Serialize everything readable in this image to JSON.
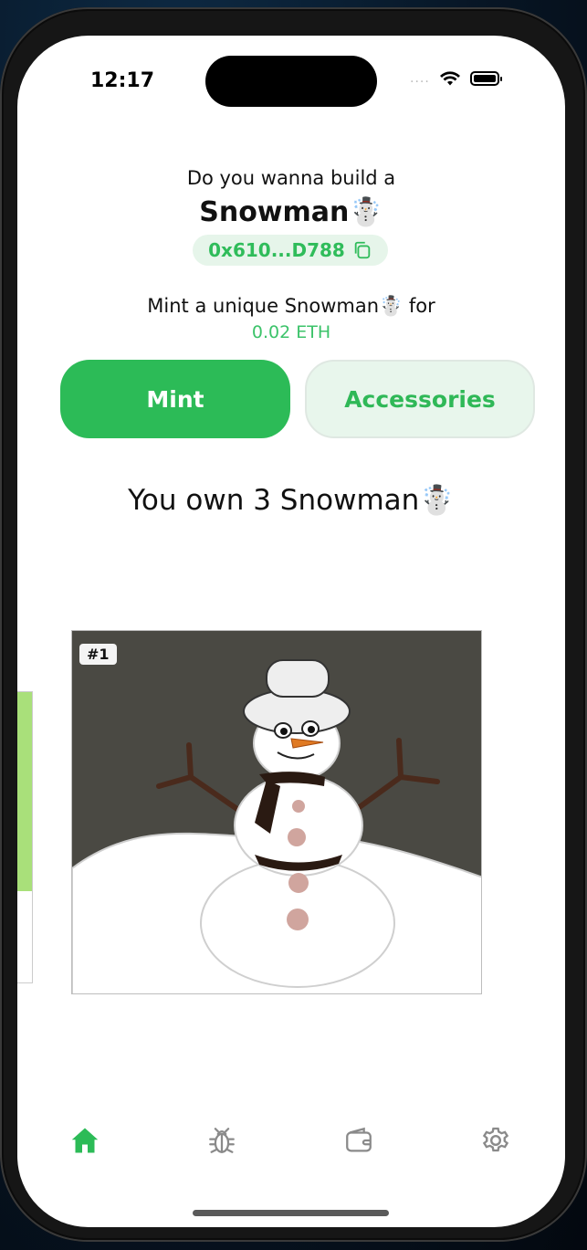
{
  "status_bar": {
    "time": "12:17",
    "signal": "...."
  },
  "header": {
    "subtitle": "Do you wanna build a",
    "title": "Snowman☃️",
    "address": "0x610...D788"
  },
  "mint_section": {
    "description": "Mint a unique Snowman☃️ for",
    "price": "0.02 ETH"
  },
  "buttons": {
    "mint_label": "Mint",
    "accessories_label": "Accessories"
  },
  "ownership": {
    "text": "You own 3 Snowman☃️"
  },
  "nft_card": {
    "badge": "#1"
  },
  "tabbar": {
    "items": [
      {
        "icon": "home-icon",
        "active": true
      },
      {
        "icon": "bug-icon",
        "active": false
      },
      {
        "icon": "wallet-icon",
        "active": false
      },
      {
        "icon": "gear-icon",
        "active": false
      }
    ]
  },
  "colors": {
    "accent": "#2cbb57",
    "accent_light": "#e8f6ec",
    "inactive_icon": "#8a8a8a"
  }
}
